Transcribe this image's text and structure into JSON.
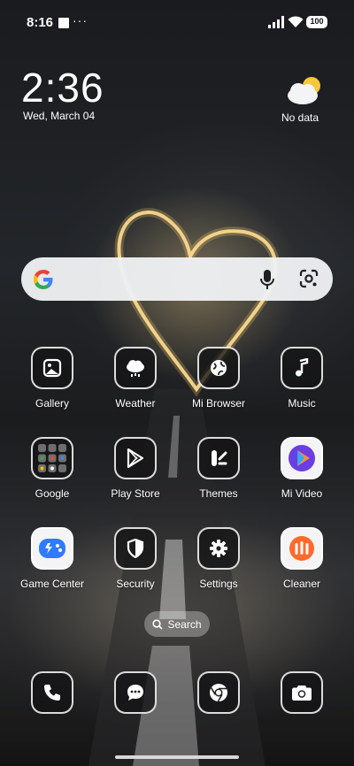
{
  "status_bar": {
    "time": "8:16",
    "more": "···",
    "battery": "100"
  },
  "clock_widget": {
    "time": "2:36",
    "date": "Wed, March 04"
  },
  "weather_widget": {
    "text": "No data"
  },
  "search_pill": {
    "label": "Search"
  },
  "apps": [
    {
      "label": "Gallery",
      "icon": "gallery-icon"
    },
    {
      "label": "Weather",
      "icon": "weather-cloud-icon"
    },
    {
      "label": "Mi Browser",
      "icon": "globe-icon"
    },
    {
      "label": "Music",
      "icon": "music-note-icon"
    },
    {
      "label": "Google",
      "icon": "google-folder-icon"
    },
    {
      "label": "Play Store",
      "icon": "play-store-icon"
    },
    {
      "label": "Themes",
      "icon": "themes-icon"
    },
    {
      "label": "Mi Video",
      "icon": "mi-video-icon"
    },
    {
      "label": "Game Center",
      "icon": "game-center-icon"
    },
    {
      "label": "Security",
      "icon": "shield-icon"
    },
    {
      "label": "Settings",
      "icon": "gear-icon"
    },
    {
      "label": "Cleaner",
      "icon": "cleaner-icon"
    }
  ],
  "dock": [
    {
      "icon": "phone-icon"
    },
    {
      "icon": "messages-icon"
    },
    {
      "icon": "chrome-icon"
    },
    {
      "icon": "camera-icon"
    }
  ]
}
